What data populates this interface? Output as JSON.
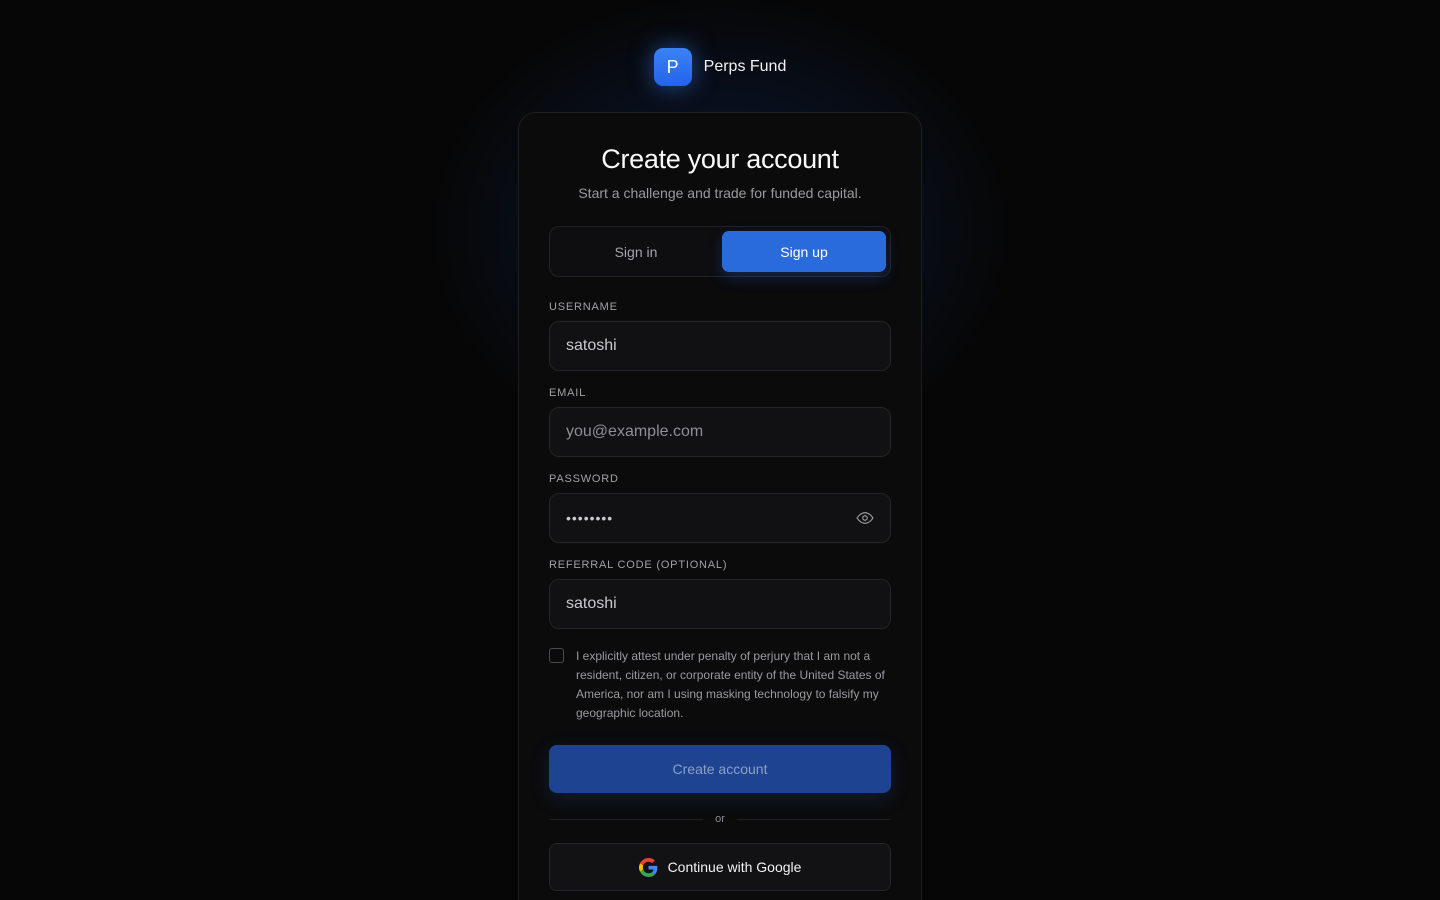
{
  "brand": {
    "logo_letter": "P",
    "name": "Perps Fund",
    "accent": "#2f74f0"
  },
  "card": {
    "title": "Create your account",
    "subtitle": "Start a challenge and trade for funded capital."
  },
  "tabs": [
    {
      "label": "Sign in",
      "active": false
    },
    {
      "label": "Sign up",
      "active": true
    }
  ],
  "fields": {
    "username": {
      "label": "USERNAME",
      "value": "satoshi",
      "placeholder": ""
    },
    "email": {
      "label": "EMAIL",
      "value": "",
      "placeholder": "you@example.com"
    },
    "password": {
      "label": "PASSWORD",
      "value": "••••••••",
      "icon": "eye-icon"
    },
    "referral": {
      "label": "REFERRAL CODE (OPTIONAL)",
      "value": "satoshi",
      "placeholder": ""
    }
  },
  "attestation": {
    "checked": false,
    "text": "I explicitly attest under penalty of perjury that I am not a resident, citizen, or corporate entity of the United States of America, nor am I using masking technology to falsify my geographic location."
  },
  "actions": {
    "create_label": "Create account",
    "divider_label": "or",
    "google_label": "Continue with Google",
    "google_icon": "google-icon"
  }
}
